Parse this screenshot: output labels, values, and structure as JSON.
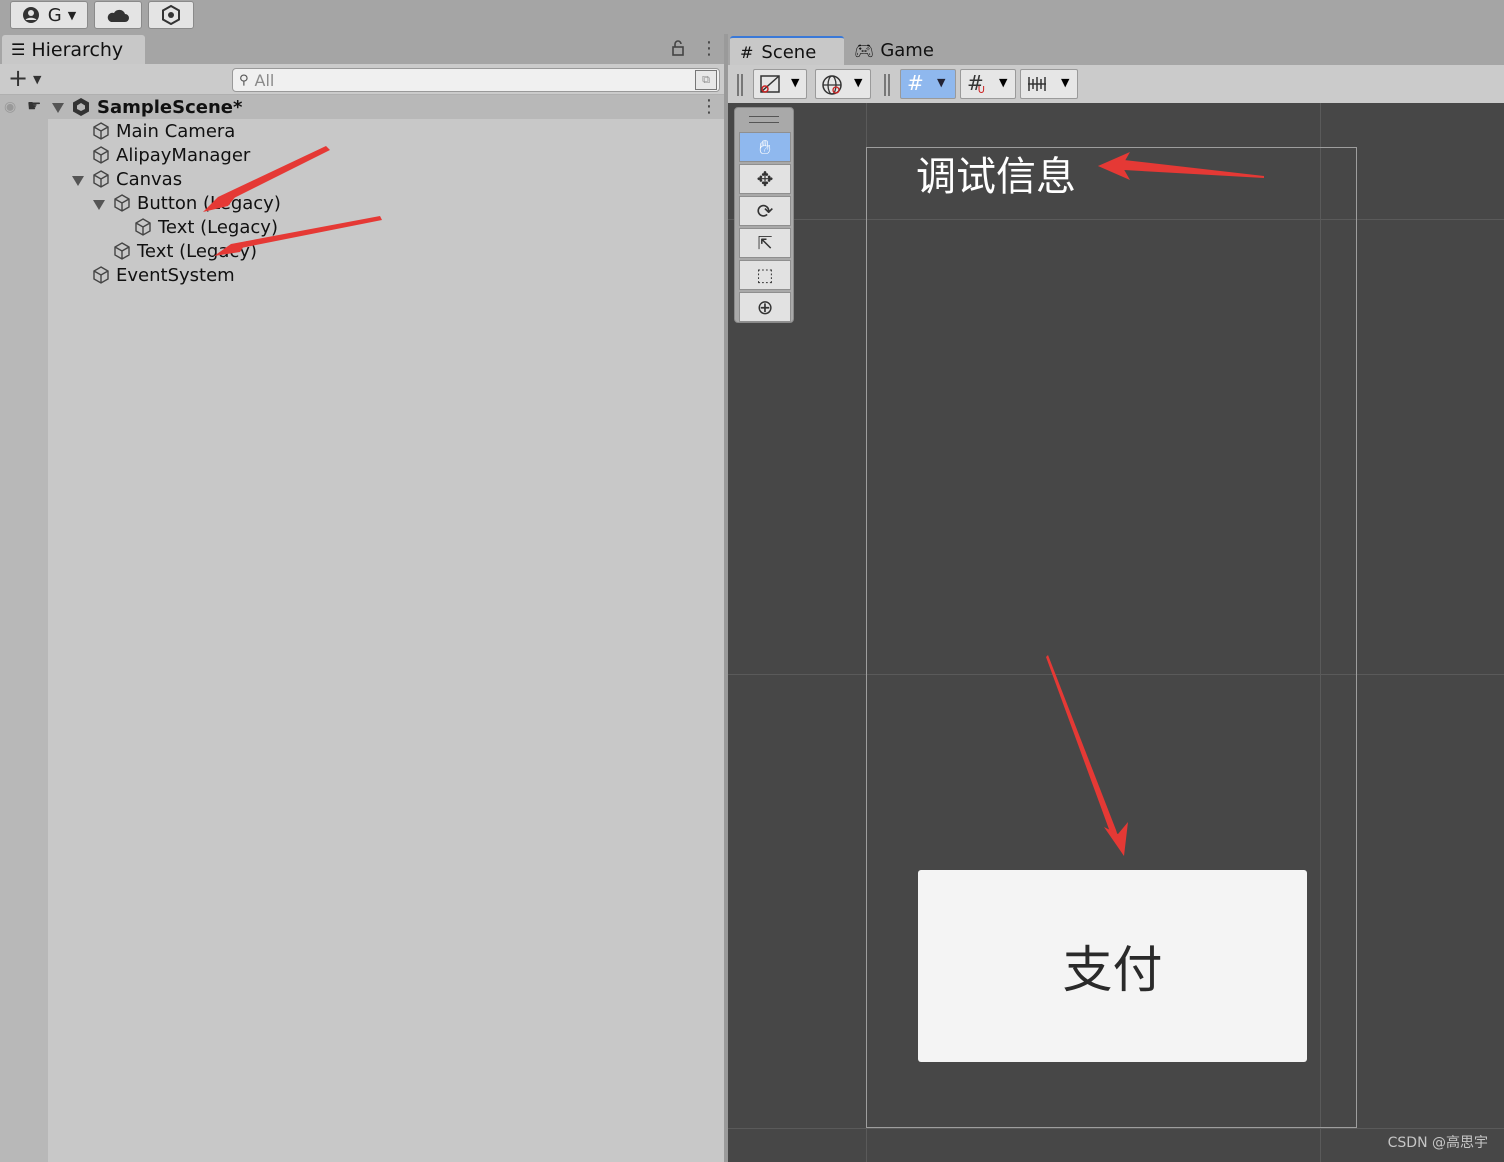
{
  "topbar": {
    "account_label": "G"
  },
  "hierarchy": {
    "tab_label": "Hierarchy",
    "search_placeholder": "All",
    "scene_name": "SampleScene*",
    "items": [
      {
        "label": "Main Camera"
      },
      {
        "label": "AlipayManager"
      },
      {
        "label": "Canvas"
      },
      {
        "label": "Button (Legacy)"
      },
      {
        "label": "Text (Legacy)"
      },
      {
        "label": "Text (Legacy)"
      },
      {
        "label": "EventSystem"
      }
    ]
  },
  "scene_view": {
    "tabs": [
      {
        "label": "Scene"
      },
      {
        "label": "Game"
      }
    ],
    "debug_text": "调试信息",
    "button_label": "支付"
  },
  "annotations": {
    "arrow_color": "#e53935"
  },
  "watermark": "CSDN @高思宇",
  "colors": {
    "scene_bg": "#474747",
    "panel_bg": "#c8c8c8",
    "accent": "#8fb8ee"
  }
}
